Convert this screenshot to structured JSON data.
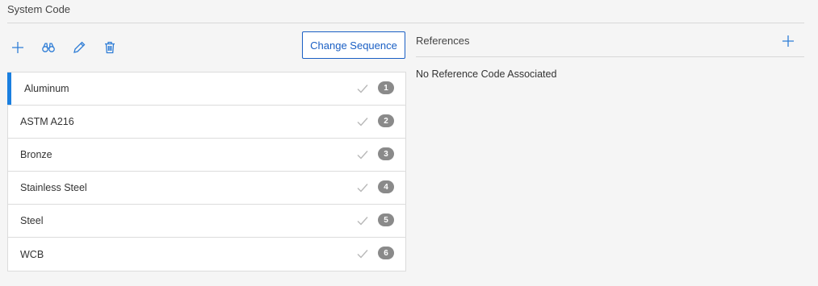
{
  "section": {
    "title": "System Code"
  },
  "toolbar": {
    "add_icon": "plus-icon",
    "search_icon": "binoculars-icon",
    "edit_icon": "pencil-icon",
    "delete_icon": "trash-icon",
    "change_sequence_label": "Change Sequence"
  },
  "list": {
    "items": [
      {
        "label": "Aluminum",
        "seq": "1",
        "selected": true
      },
      {
        "label": "ASTM A216",
        "seq": "2",
        "selected": false
      },
      {
        "label": "Bronze",
        "seq": "3",
        "selected": false
      },
      {
        "label": "Stainless Steel",
        "seq": "4",
        "selected": false
      },
      {
        "label": "Steel",
        "seq": "5",
        "selected": false
      },
      {
        "label": "WCB",
        "seq": "6",
        "selected": false
      }
    ]
  },
  "references": {
    "title": "References",
    "empty_message": "No Reference Code Associated",
    "add_icon": "plus-icon"
  },
  "colors": {
    "accent": "#1a5fc4",
    "selected_bar": "#1a7fe0",
    "badge": "#8a8a8a",
    "check": "#b8b8b8"
  }
}
